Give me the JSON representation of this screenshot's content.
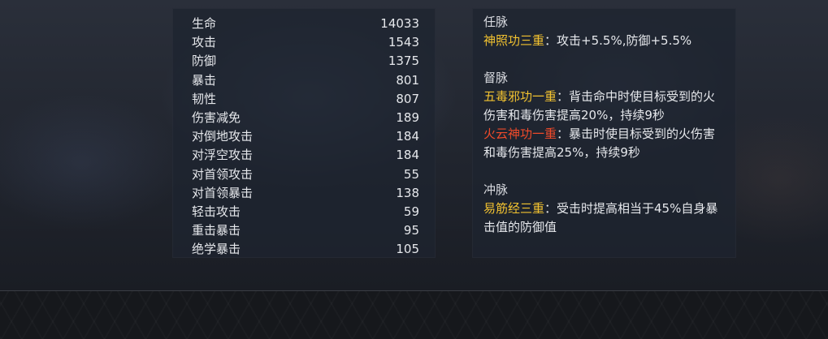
{
  "stats": [
    {
      "name": "生命",
      "value": "14033"
    },
    {
      "name": "攻击",
      "value": "1543"
    },
    {
      "name": "防御",
      "value": "1375"
    },
    {
      "name": "暴击",
      "value": "801"
    },
    {
      "name": "韧性",
      "value": "807"
    },
    {
      "name": "伤害减免",
      "value": "189"
    },
    {
      "name": "对倒地攻击",
      "value": "184"
    },
    {
      "name": "对浮空攻击",
      "value": "184"
    },
    {
      "name": "对首领攻击",
      "value": "55"
    },
    {
      "name": "对首领暴击",
      "value": "138"
    },
    {
      "name": "轻击攻击",
      "value": "59"
    },
    {
      "name": "重击暴击",
      "value": "95"
    },
    {
      "name": "绝学暴击",
      "value": "105"
    }
  ],
  "meridians": [
    {
      "title": "任脉",
      "skills": [
        {
          "name": "神照功三重",
          "color": "#f2c230",
          "desc": "：攻击+5.5%,防御+5.5%"
        }
      ]
    },
    {
      "title": "督脉",
      "skills": [
        {
          "name": "五毒邪功一重",
          "color": "#f2c230",
          "desc": "：背击命中时使目标受到的火伤害和毒伤害提高20%，持续9秒"
        },
        {
          "name": "火云神功一重",
          "color": "#ef4a2a",
          "desc": "：暴击时使目标受到的火伤害和毒伤害提高25%，持续9秒"
        }
      ]
    },
    {
      "title": "冲脉",
      "skills": [
        {
          "name": "易筋经三重",
          "color": "#f2c230",
          "desc": "：受击时提高相当于45%自身暴击值的防御值"
        }
      ]
    }
  ]
}
